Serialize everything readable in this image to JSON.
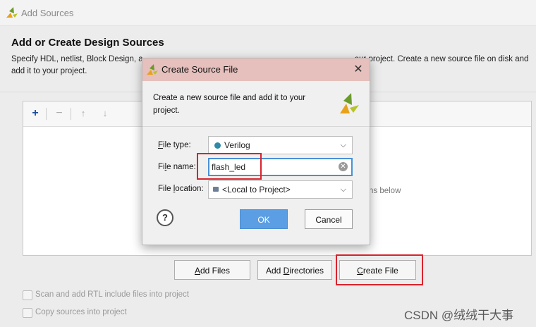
{
  "window": {
    "title": "Add Sources"
  },
  "main": {
    "heading": "Add or Create Design Sources",
    "description": "Specify HDL, netlist, Block Design, a… IP files, or directories containing those files to add to your project. Create a new source file on disk and add it to your project.",
    "desc_line1_left": "Specify HDL, netlist, Block Design, a",
    "desc_line1_right": "our project. Create a new source file on disk and",
    "desc_line2": "add it to your project.",
    "hint_text": "ns below"
  },
  "toolbar": {
    "add_icon": "+",
    "remove_icon": "−",
    "up_icon": "↑",
    "down_icon": "↓"
  },
  "buttons": {
    "add_files": {
      "prefix": "",
      "accel": "A",
      "rest": "dd Files"
    },
    "add_dirs": {
      "prefix": "Add ",
      "accel": "D",
      "rest": "irectories"
    },
    "create_file": {
      "prefix": "",
      "accel": "C",
      "rest": "reate File"
    }
  },
  "options": [
    {
      "label": "Scan and add RTL include files into project"
    },
    {
      "label": "Copy sources into project"
    }
  ],
  "watermark": "CSDN @绒绒干大事",
  "dialog": {
    "title": "Create Source File",
    "close": "✕",
    "message": "Create a new source file and add it to your project.",
    "file_type": {
      "label_accel": "F",
      "label_rest": "ile type:",
      "value": "Verilog"
    },
    "file_name": {
      "label_prefix": "Fi",
      "label_accel": "l",
      "label_rest": "e name:",
      "value": "flash_led"
    },
    "file_location": {
      "label_prefix": "File ",
      "label_accel": "l",
      "label_rest": "ocation:",
      "value": "<Local to Project>"
    },
    "help": "?",
    "ok": "OK",
    "cancel": "Cancel"
  },
  "colors": {
    "highlight": "#d9232d",
    "ok_button": "#5b9ee3",
    "title_bar": "#e5c0bd"
  }
}
